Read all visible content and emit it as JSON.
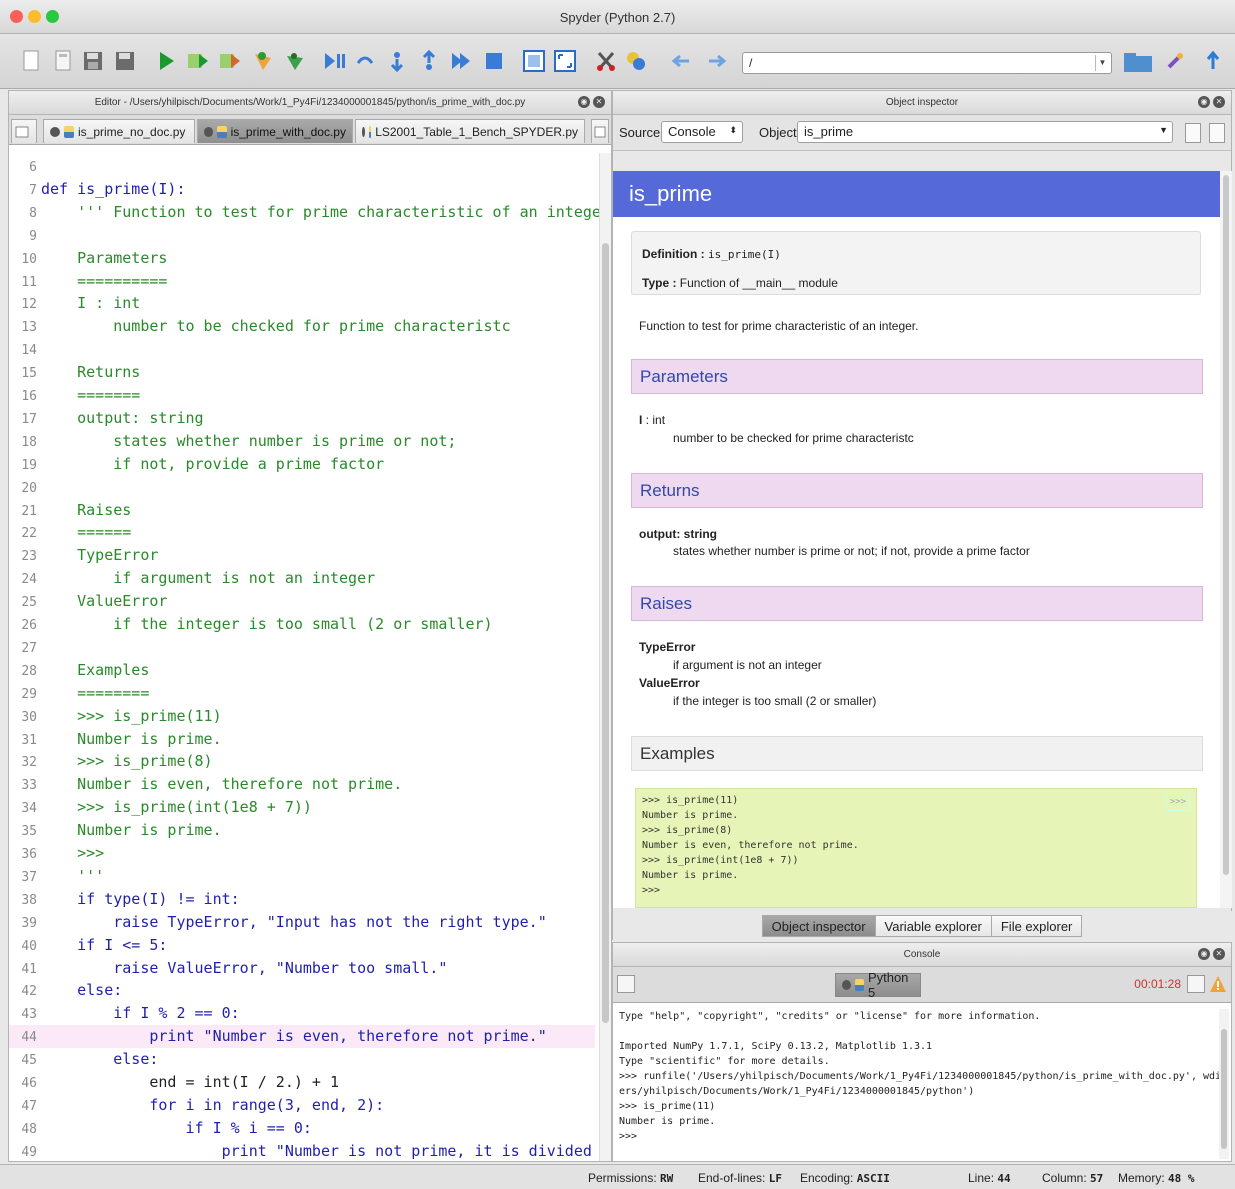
{
  "window": {
    "title": "Spyder (Python 2.7)"
  },
  "toolbar": {
    "path_value": "/",
    "icons": [
      "new-file-icon",
      "open-file-icon",
      "save-icon",
      "save-all-icon",
      "run-icon",
      "run-config-icon",
      "rerun-icon",
      "debug-icon",
      "run-selection-icon",
      "run-cell-icon",
      "step-icon",
      "step-into-icon",
      "step-return-icon",
      "continue-icon",
      "stop-icon",
      "maximize-pane-icon",
      "fullscreen-icon",
      "tools-icon",
      "python-path-icon",
      "back-icon",
      "forward-icon",
      "folder-icon",
      "parent-dir-icon"
    ]
  },
  "editor": {
    "title": "Editor - /Users/yhilpisch/Documents/Work/1_Py4Fi/1234000001845/python/is_prime_with_doc.py",
    "tabs": [
      {
        "label": "is_prime_no_doc.py",
        "active": false
      },
      {
        "label": "is_prime_with_doc.py",
        "active": true
      },
      {
        "label": "LS2001_Table_1_Bench_SPYDER.py",
        "active": false
      }
    ],
    "highlighted_line": 44,
    "lines": [
      {
        "n": "6",
        "t": ""
      },
      {
        "n": "7",
        "t": "def is_prime(I):"
      },
      {
        "n": "8",
        "t": "    ''' Function to test for prime characteristic of an integer."
      },
      {
        "n": "9",
        "t": ""
      },
      {
        "n": "10",
        "t": "    Parameters"
      },
      {
        "n": "11",
        "t": "    =========="
      },
      {
        "n": "12",
        "t": "    I : int"
      },
      {
        "n": "13",
        "t": "        number to be checked for prime characteristc"
      },
      {
        "n": "14",
        "t": ""
      },
      {
        "n": "15",
        "t": "    Returns"
      },
      {
        "n": "16",
        "t": "    ======="
      },
      {
        "n": "17",
        "t": "    output: string"
      },
      {
        "n": "18",
        "t": "        states whether number is prime or not;"
      },
      {
        "n": "19",
        "t": "        if not, provide a prime factor"
      },
      {
        "n": "20",
        "t": ""
      },
      {
        "n": "21",
        "t": "    Raises"
      },
      {
        "n": "22",
        "t": "    ======"
      },
      {
        "n": "23",
        "t": "    TypeError"
      },
      {
        "n": "24",
        "t": "        if argument is not an integer"
      },
      {
        "n": "25",
        "t": "    ValueError"
      },
      {
        "n": "26",
        "t": "        if the integer is too small (2 or smaller)"
      },
      {
        "n": "27",
        "t": ""
      },
      {
        "n": "28",
        "t": "    Examples"
      },
      {
        "n": "29",
        "t": "    ========"
      },
      {
        "n": "30",
        "t": "    >>> is_prime(11)"
      },
      {
        "n": "31",
        "t": "    Number is prime."
      },
      {
        "n": "32",
        "t": "    >>> is_prime(8)"
      },
      {
        "n": "33",
        "t": "    Number is even, therefore not prime."
      },
      {
        "n": "34",
        "t": "    >>> is_prime(int(1e8 + 7))"
      },
      {
        "n": "35",
        "t": "    Number is prime."
      },
      {
        "n": "36",
        "t": "    >>>"
      },
      {
        "n": "37",
        "t": "    '''"
      },
      {
        "n": "38",
        "t": "    if type(I) != int:"
      },
      {
        "n": "39",
        "t": "        raise TypeError, \"Input has not the right type.\""
      },
      {
        "n": "40",
        "t": "    if I <= 5:"
      },
      {
        "n": "41",
        "t": "        raise ValueError, \"Number too small.\""
      },
      {
        "n": "42",
        "t": "    else:"
      },
      {
        "n": "43",
        "t": "        if I % 2 == 0:"
      },
      {
        "n": "44",
        "t": "            print \"Number is even, therefore not prime.\""
      },
      {
        "n": "45",
        "t": "        else:"
      },
      {
        "n": "46",
        "t": "            end = int(I / 2.) + 1"
      },
      {
        "n": "47",
        "t": "            for i in range(3, end, 2):"
      },
      {
        "n": "48",
        "t": "                if I % i == 0:"
      },
      {
        "n": "49",
        "t": "                    print \"Number is not prime, it is divided by %d.\" % i"
      }
    ]
  },
  "inspector": {
    "title": "Object inspector",
    "source_label": "Source",
    "source_value": "Console",
    "object_label": "Object",
    "object_value": "is_prime",
    "doc_title": "is_prime",
    "definition_label": "Definition :",
    "definition_value": "is_prime(I)",
    "type_label": "Type :",
    "type_value": "Function of __main__ module",
    "summary": "Function to test for prime characteristic of an integer.",
    "parameters_heading": "Parameters",
    "param_name": "I",
    "param_type": ": int",
    "param_desc": "number to be checked for prime characteristc",
    "returns_heading": "Returns",
    "return_name": "output: string",
    "return_desc": "states whether number is prime or not; if not, provide a prime factor",
    "raises_heading": "Raises",
    "raise1_name": "TypeError",
    "raise1_desc": "if argument is not an integer",
    "raise2_name": "ValueError",
    "raise2_desc": "if the integer is too small (2 or smaller)",
    "examples_heading": "Examples",
    "examples": [
      ">>> is_prime(11)",
      "Number is prime.",
      ">>> is_prime(8)",
      "Number is even, therefore not prime.",
      ">>> is_prime(int(1e8 + 7))",
      "Number is prime.",
      ">>>"
    ],
    "examples_toggle": ">>>",
    "bottom_tabs": [
      "Object inspector",
      "Variable explorer",
      "File explorer"
    ]
  },
  "console": {
    "title": "Console",
    "tab_label": "Python 5",
    "timer": "00:01:28",
    "output": [
      "Type \"help\", \"copyright\", \"credits\" or \"license\" for more information.",
      "",
      "Imported NumPy 1.7.1, SciPy 0.13.2, Matplotlib 1.3.1",
      "Type \"scientific\" for more details.",
      ">>> runfile('/Users/yhilpisch/Documents/Work/1_Py4Fi/1234000001845/python/is_prime_with_doc.py', wdir=r'/Us",
      "ers/yhilpisch/Documents/Work/1_Py4Fi/1234000001845/python')",
      ">>> is_prime(11)",
      "Number is prime.",
      ">>>"
    ]
  },
  "status": {
    "permissions_label": "Permissions:",
    "permissions_value": "RW",
    "eol_label": "End-of-lines:",
    "eol_value": "LF",
    "encoding_label": "Encoding:",
    "encoding_value": "ASCII",
    "line_label": "Line:",
    "line_value": "44",
    "column_label": "Column:",
    "column_value": "57",
    "memory_label": "Memory:",
    "memory_value": "48 %"
  },
  "colors": {
    "accent": "#5669d8",
    "section_bg": "#efd9f0",
    "examples_bg": "#e6f5b7",
    "keyword": "#1f1fb0",
    "docstring": "#2a8a2a"
  }
}
